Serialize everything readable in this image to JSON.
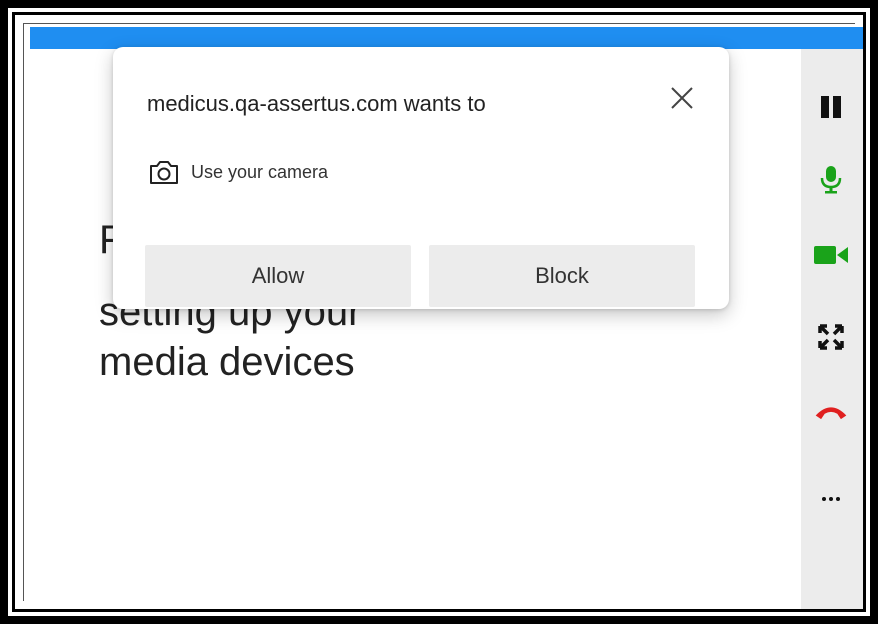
{
  "page": {
    "heading_lines": [
      "F",
      "setting up your",
      "media devices"
    ]
  },
  "permission_prompt": {
    "title": "medicus.qa-assertus.com wants to",
    "permission_label": "Use your camera",
    "permission_icon": "camera-icon",
    "allow_label": "Allow",
    "block_label": "Block",
    "close_icon": "close-icon"
  },
  "call_controls": [
    {
      "name": "pause",
      "icon": "pause-icon",
      "color": "#111111"
    },
    {
      "name": "microphone",
      "icon": "microphone-icon",
      "color": "#1aa31a"
    },
    {
      "name": "camera",
      "icon": "video-camera-icon",
      "color": "#1aa31a"
    },
    {
      "name": "fullscreen",
      "icon": "fullscreen-icon",
      "color": "#111111"
    },
    {
      "name": "hang-up",
      "icon": "hang-up-icon",
      "color": "#e02020"
    },
    {
      "name": "more",
      "icon": "more-icon",
      "color": "#111111"
    }
  ],
  "colors": {
    "top_bar": "#1f8ef1",
    "rail_background": "#ececec",
    "button_background": "#ececec"
  }
}
